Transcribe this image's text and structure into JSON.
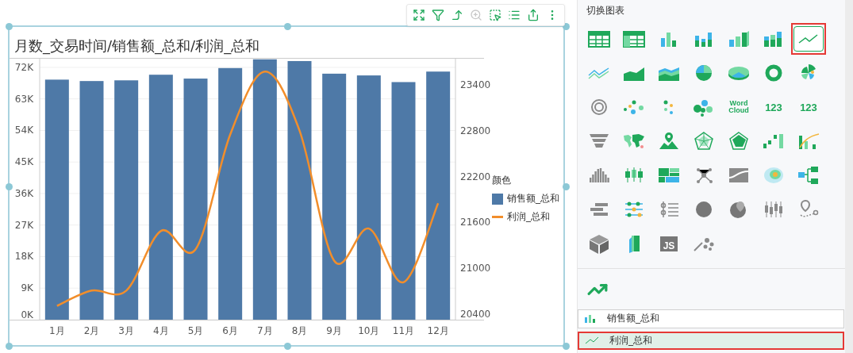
{
  "toolbar": [
    {
      "disabled": false
    },
    {
      "disabled": false
    },
    {
      "disabled": false
    },
    {
      "disabled": true
    },
    {
      "disabled": false
    },
    {
      "disabled": false
    },
    {
      "disabled": false
    },
    {
      "disabled": false
    }
  ],
  "chart": {
    "title": "月数_交易时间/销售额_总和/利润_总和",
    "chart_data": {
      "type": "bar",
      "categories": [
        "1月",
        "2月",
        "3月",
        "4月",
        "5月",
        "6月",
        "7月",
        "8月",
        "9月",
        "10月",
        "11月",
        "12月"
      ],
      "series": [
        {
          "name": "销售额_总和",
          "color": "#4e79a7",
          "values": [
            68500,
            68100,
            68300,
            69900,
            68800,
            71800,
            74300,
            73800,
            70200,
            69700,
            67800,
            70800
          ]
        },
        {
          "name": "利润_总和",
          "color": "#f28e2b",
          "type": "line",
          "axis": "y2",
          "values": [
            20510,
            20710,
            20710,
            21490,
            21250,
            22750,
            23570,
            22800,
            21100,
            21520,
            20820,
            21850
          ]
        }
      ],
      "stacked": false,
      "grid": true,
      "ylim": [
        0,
        74700
      ],
      "yticks": [
        {
          "value": 0,
          "label": "0K"
        },
        {
          "value": 9000,
          "label": "9K"
        },
        {
          "value": 18000,
          "label": "18K"
        },
        {
          "value": 27000,
          "label": "27K"
        },
        {
          "value": 36000,
          "label": "36K"
        },
        {
          "value": 45000,
          "label": "45K"
        },
        {
          "value": 54000,
          "label": "54K"
        },
        {
          "value": 63000,
          "label": "63K"
        },
        {
          "value": 72000,
          "label": "72K"
        }
      ],
      "y2lim": [
        20330,
        23750
      ],
      "y2ticks": [
        20400,
        21000,
        21600,
        22200,
        22800,
        23400
      ]
    },
    "legend": {
      "title": "颜色"
    }
  },
  "panel": {
    "title": "切换图表",
    "icons": [
      {
        "selected": false
      },
      {
        "selected": false
      },
      {
        "selected": false
      },
      {
        "selected": false
      },
      {
        "selected": false
      },
      {
        "selected": false
      },
      {
        "selected": true
      },
      {
        "selected": false
      },
      {
        "selected": false
      },
      {
        "selected": false
      },
      {
        "selected": false
      },
      {
        "selected": false
      },
      {
        "selected": false
      },
      {
        "selected": false
      },
      {
        "selected": false
      },
      {
        "selected": false
      },
      {
        "selected": false
      },
      {
        "selected": false
      },
      {
        "selected": false,
        "text": "Word Cloud"
      },
      {
        "selected": false,
        "text": "123"
      },
      {
        "selected": false,
        "text": "123"
      },
      {
        "selected": false
      },
      {
        "selected": false
      },
      {
        "selected": false
      },
      {
        "selected": false
      },
      {
        "selected": false
      },
      {
        "selected": false
      },
      {
        "selected": false
      },
      {
        "selected": false
      },
      {
        "selected": false
      },
      {
        "selected": false
      },
      {
        "selected": false
      },
      {
        "selected": false
      },
      {
        "selected": false
      },
      {
        "selected": false
      },
      {
        "selected": false
      },
      {
        "selected": false
      },
      {
        "selected": false
      },
      {
        "selected": false
      },
      {
        "selected": false
      },
      {
        "selected": false
      },
      {
        "selected": false
      },
      {
        "selected": false
      },
      {
        "selected": false
      },
      {
        "selected": false,
        "text": "JS"
      },
      {
        "selected": false
      }
    ],
    "series": [
      {
        "label": "销售额_总和",
        "kind": "bar",
        "selected": false
      },
      {
        "label": "利润_总和",
        "kind": "line",
        "selected": true
      }
    ]
  }
}
